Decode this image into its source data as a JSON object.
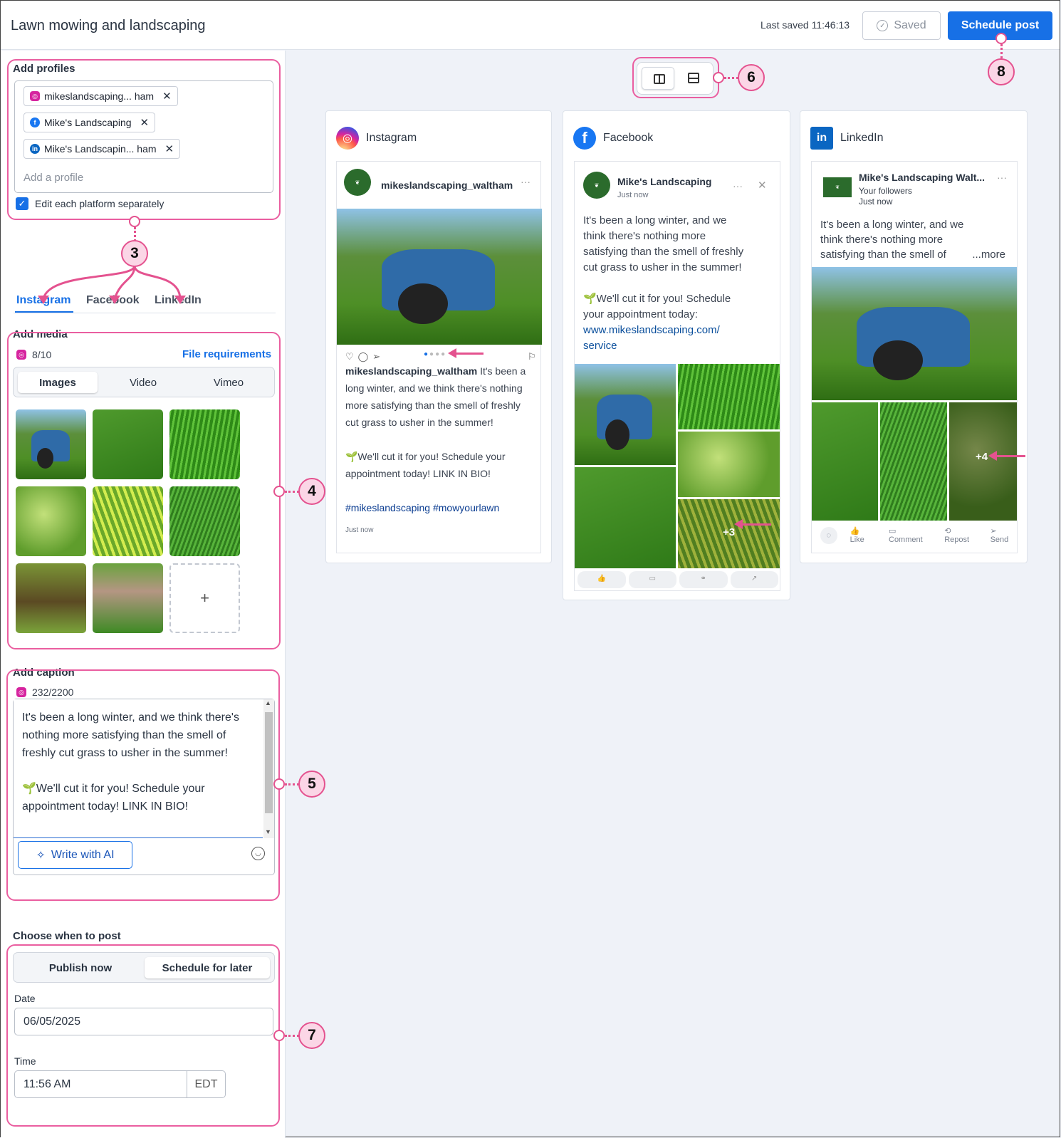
{
  "header": {
    "title": "Lawn mowing and landscaping",
    "last_saved": "Last saved 11:46:13",
    "saved_label": "Saved",
    "schedule_label": "Schedule post"
  },
  "profiles": {
    "title": "Add profiles",
    "items": [
      {
        "label": "mikeslandscaping... ham",
        "platform": "instagram-icon"
      },
      {
        "label": "Mike's Landscaping",
        "platform": "facebook-icon"
      },
      {
        "label": "Mike's Landscapin... ham",
        "platform": "linkedin-icon"
      }
    ],
    "placeholder": "Add a profile",
    "edit_separately": "Edit each platform separately"
  },
  "tabs": [
    "Instagram",
    "Facebook",
    "LinkedIn"
  ],
  "media": {
    "title": "Add media",
    "count": "8/10",
    "requirements": "File requirements",
    "types": [
      "Images",
      "Video",
      "Vimeo"
    ]
  },
  "caption": {
    "title": "Add caption",
    "count": "232/2200",
    "line1": "It's been a long winter, and we think there's",
    "line2": "nothing more satisfying than the smell of",
    "line3": "freshly cut grass to usher in the summer!",
    "line4": "🌱We'll cut it for you! Schedule your",
    "line5": "appointment today! LINK IN BIO!",
    "ai_label": "Write with AI"
  },
  "schedule": {
    "title": "Choose when to post",
    "options": [
      "Publish now",
      "Schedule for later"
    ],
    "date_label": "Date",
    "date_value": "06/05/2025",
    "time_label": "Time",
    "time_value": "11:56 AM",
    "timezone": "EDT"
  },
  "previews": {
    "instagram": {
      "platform": "Instagram",
      "account": "mikeslandscaping_waltham",
      "cap_user": "mikeslandscaping_waltham",
      "cap_l1": " It's been a",
      "cap_l2": "long winter, and we think there's nothing",
      "cap_l3": "more satisfying than the smell of freshly",
      "cap_l4": "cut grass to usher in the summer!",
      "cap_l5": "🌱We'll cut it for you! Schedule your",
      "cap_l6": "appointment today! LINK IN BIO!",
      "hashtags": "#mikeslandscaping #mowyourlawn",
      "time": "Just now"
    },
    "facebook": {
      "platform": "Facebook",
      "account": "Mike's Landscaping",
      "time": "Just now",
      "l1": "It's been a long winter, and we",
      "l2": "think there's nothing more",
      "l3": "satisfying than the smell of freshly",
      "l4": "cut grass to usher in the summer!",
      "l5": "🌱We'll cut it for you! Schedule",
      "l6": "your appointment today:",
      "link1": "www.mikeslandscaping.com/",
      "link2": "service",
      "more_count": "+3"
    },
    "linkedin": {
      "platform": "LinkedIn",
      "account": "Mike's Landscaping Walt...",
      "audience": "Your followers",
      "time": "Just now",
      "l1": "It's been a long winter, and we",
      "l2": "think there's nothing more",
      "l3": "satisfying than the smell of",
      "more": "...more",
      "more_count": "+4",
      "actions": [
        "Like",
        "Comment",
        "Repost",
        "Send"
      ]
    }
  },
  "annotations": [
    "3",
    "4",
    "5",
    "6",
    "7",
    "8"
  ],
  "colors": {
    "accent": "#1770e6",
    "annotation": "#e4528f"
  }
}
